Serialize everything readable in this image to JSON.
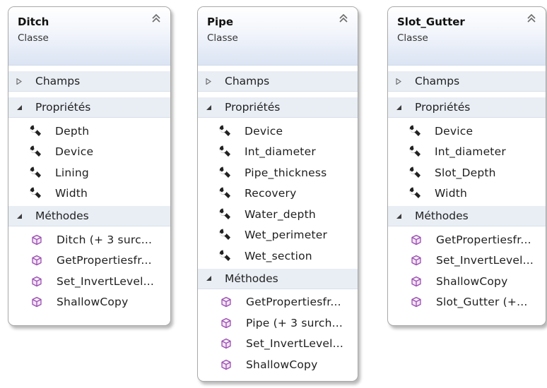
{
  "colors": {
    "header_top": "#ffffff",
    "header_bottom": "#dbe4f3",
    "section_bg": "#e9eef5",
    "method_icon": "#9b4fb1",
    "wrench_icon": "#222222",
    "border": "#a9a9a9"
  },
  "icons": {
    "collapse": "double-chevron-up-icon",
    "property": "wrench-icon",
    "method": "method-cube-icon",
    "expanded": "triangle-down-icon",
    "collapsed": "triangle-right-icon"
  },
  "classes": [
    {
      "name": "Ditch",
      "kind": "Classe",
      "fields_label": "Champs",
      "properties_label": "Propriétés",
      "properties": [
        "Depth",
        "Device",
        "Lining",
        "Width"
      ],
      "methods_label": "Méthodes",
      "methods": [
        "Ditch (+ 3 surc...",
        "GetPropertiesfr...",
        "Set_InvertLevel...",
        "ShallowCopy"
      ]
    },
    {
      "name": "Pipe",
      "kind": "Classe",
      "fields_label": "Champs",
      "properties_label": "Propriétés",
      "properties": [
        "Device",
        "Int_diameter",
        "Pipe_thickness",
        "Recovery",
        "Water_depth",
        "Wet_perimeter",
        "Wet_section"
      ],
      "methods_label": "Méthodes",
      "methods": [
        "GetPropertiesfr...",
        "Pipe (+ 3 surch...",
        "Set_InvertLevel...",
        "ShallowCopy"
      ]
    },
    {
      "name": "Slot_Gutter",
      "kind": "Classe",
      "fields_label": "Champs",
      "properties_label": "Propriétés",
      "properties": [
        "Device",
        "Int_diameter",
        "Slot_Depth",
        "Width"
      ],
      "methods_label": "Méthodes",
      "methods": [
        "GetPropertiesfr...",
        "Set_InvertLevel...",
        "ShallowCopy",
        "Slot_Gutter (+..."
      ]
    }
  ]
}
